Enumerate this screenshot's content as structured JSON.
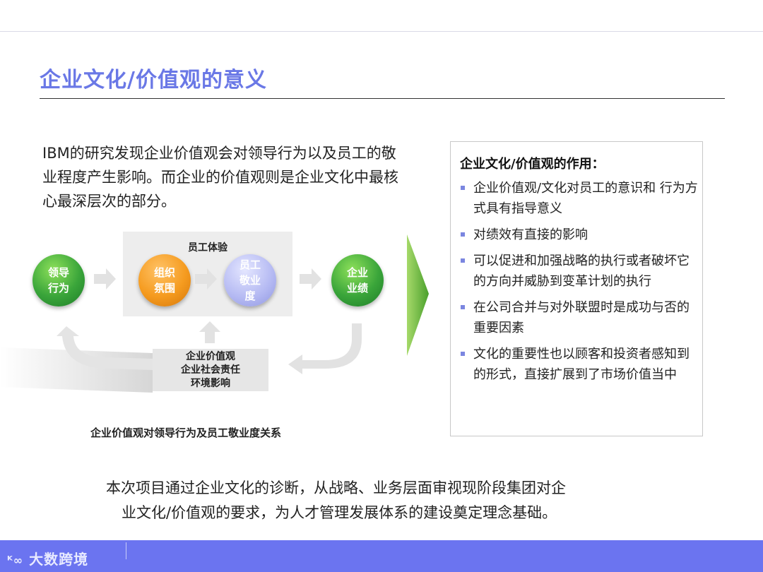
{
  "title": "企业文化/价值观的意义",
  "intro": "IBM的研究发现企业价值观会对领导行为以及员工的敬业程度产生影响。而企业的价值观则是企业文化中最核心最深层次的部分。",
  "diagram": {
    "experience_label": "员工体验",
    "nodes": {
      "leadership": "领导\n行为",
      "atmosphere": "组织\n氛围",
      "engagement": "员工\n敬业\n度",
      "performance": "企业\n业绩"
    },
    "values_lines": [
      "企业价值观",
      "企业社会责任",
      "环境影响"
    ],
    "caption": "企业价值观对领导行为及员工敬业度关系"
  },
  "panel": {
    "title": "企业文化/价值观的作用：",
    "items": [
      "企业价值观/文化对员工的意识和 行为方式具有指导意义",
      "对绩效有直接的影响",
      "可以促进和加强战略的执行或者破坏它的方向并威胁到变革计划的执行",
      "在公司合并与对外联盟时是成功与否的重要因素",
      "文化的重要性也以顾客和投资者感知到的形式，直接扩展到了市场价值当中"
    ]
  },
  "summary": [
    "本次项目通过企业文化的诊断，从战略、业务层面审视现阶段集团对企",
    "业文化/价值观的要求，为人才管理发展体系的建设奠定理念基础。"
  ],
  "footer": {
    "logo_text": "大数跨境"
  },
  "colors": {
    "title": "#6a78e6",
    "green": "#3aa53a",
    "orange": "#f59b1f",
    "lavender": "#b3b8f2",
    "bullet": "#7b86e0",
    "footer": "#6b74f0",
    "big_arrow": "#7cc23a"
  }
}
